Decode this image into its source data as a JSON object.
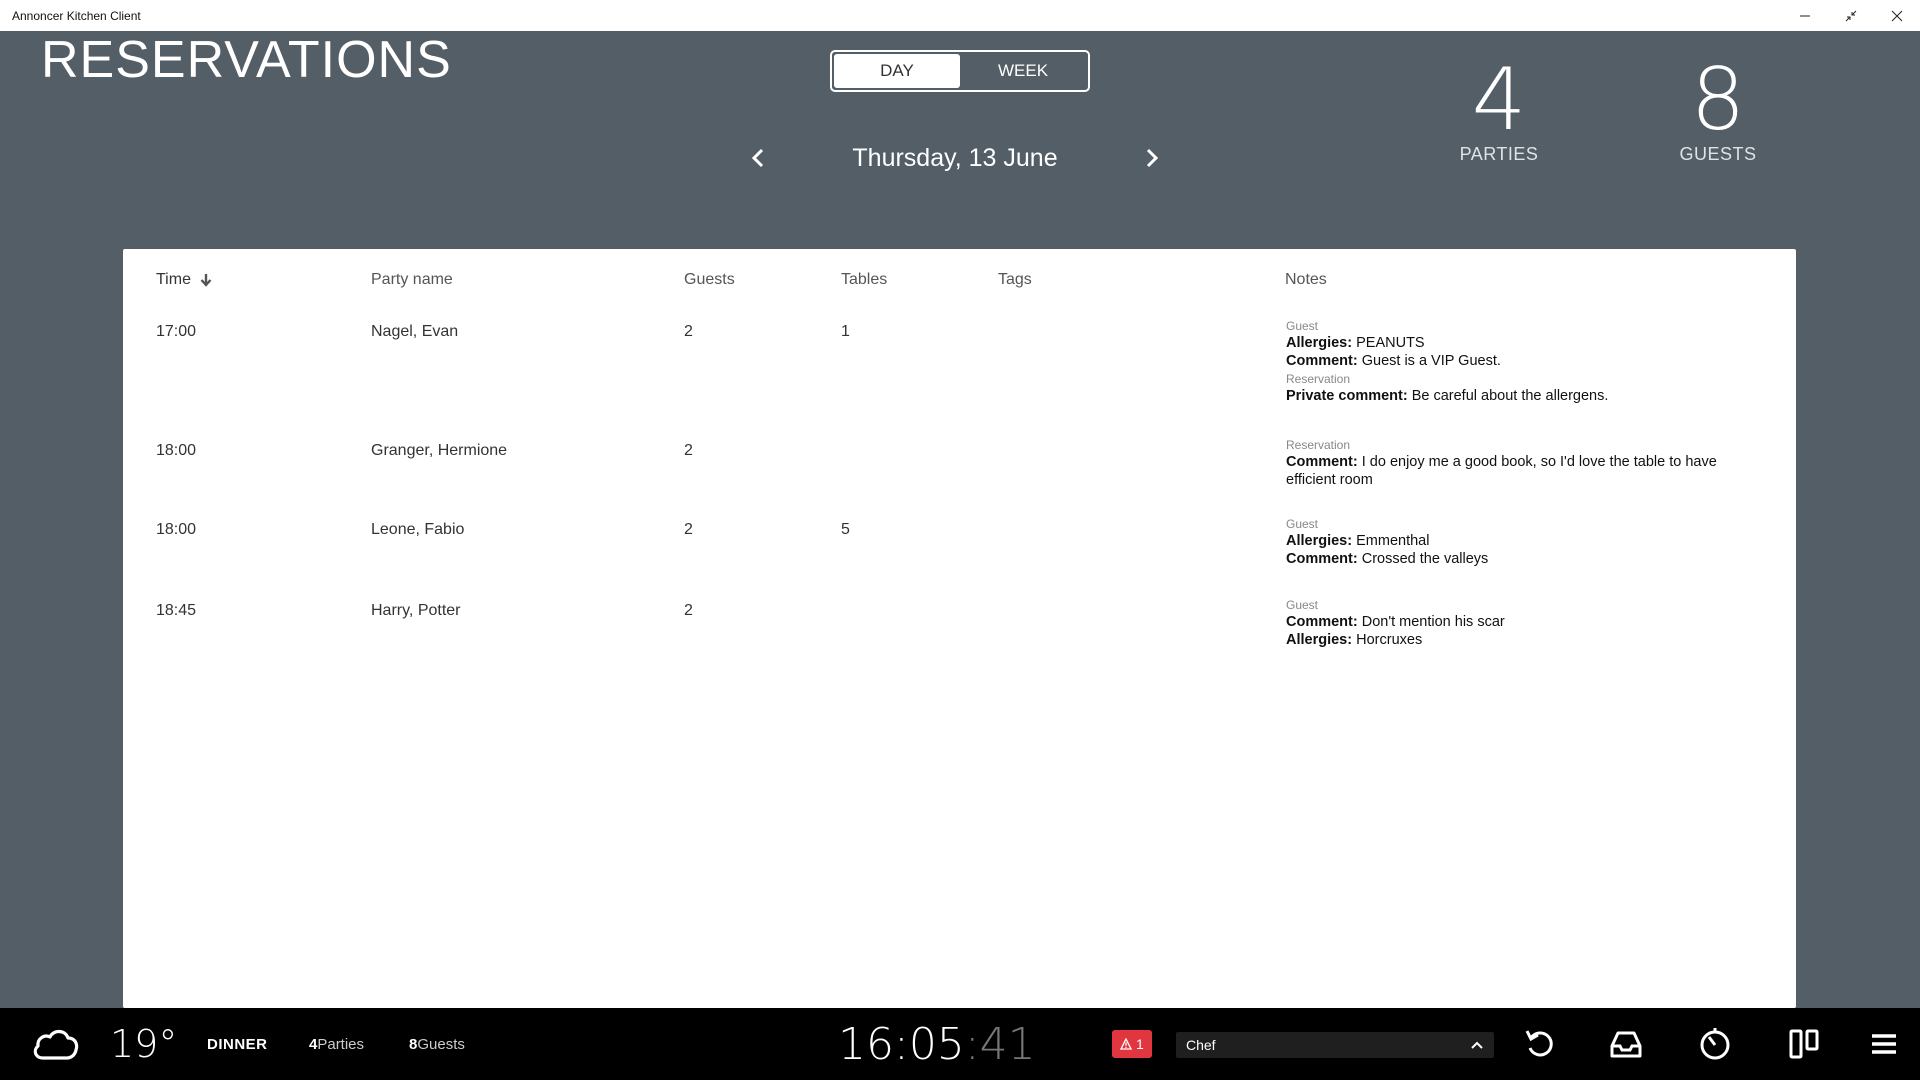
{
  "window": {
    "title": "Annoncer Kitchen Client"
  },
  "header": {
    "title": "RESERVATIONS",
    "view_toggle": {
      "day": "DAY",
      "week": "WEEK",
      "active": "day"
    },
    "date": "Thursday, 13 June",
    "stats": {
      "parties_value": "4",
      "parties_label": "PARTIES",
      "guests_value": "8",
      "guests_label": "GUESTS"
    }
  },
  "table": {
    "columns": {
      "time": "Time",
      "party": "Party name",
      "guests": "Guests",
      "tables": "Tables",
      "tags": "Tags",
      "notes": "Notes"
    },
    "rows": [
      {
        "time": "17:00",
        "party": "Nagel, Evan",
        "guests": "2",
        "tables": "1",
        "tags": "",
        "notes": {
          "s1_label": "Guest",
          "s1_l1_key": "Allergies:",
          "s1_l1_val": " PEANUTS",
          "s1_l2_key": "Comment:",
          "s1_l2_val": " Guest is a VIP Guest.",
          "s2_label": "Reservation",
          "s2_l1_key": "Private comment:",
          "s2_l1_val": " Be careful about the allergens."
        }
      },
      {
        "time": "18:00",
        "party": "Granger, Hermione",
        "guests": "2",
        "tables": "",
        "tags": "",
        "notes": {
          "s1_label": "Reservation",
          "s1_l1_key": "Comment:",
          "s1_l1_val": " I do enjoy me a good book, so I'd love the table to have efficient room"
        }
      },
      {
        "time": "18:00",
        "party": "Leone, Fabio",
        "guests": "2",
        "tables": "5",
        "tags": "",
        "notes": {
          "s1_label": "Guest",
          "s1_l1_key": "Allergies:",
          "s1_l1_val": " Emmenthal",
          "s1_l2_key": "Comment:",
          "s1_l2_val": " Crossed the valleys"
        }
      },
      {
        "time": "18:45",
        "party": "Harry, Potter",
        "guests": "2",
        "tables": "",
        "tags": "",
        "notes": {
          "s1_label": "Guest",
          "s1_l1_key": "Comment:",
          "s1_l1_val": " Don't mention his scar",
          "s1_l2_key": "Allergies:",
          "s1_l2_val": " Horcruxes"
        }
      }
    ]
  },
  "footer": {
    "weather_icon": "cloud-icon",
    "temperature": "19°",
    "service": "DINNER",
    "parties_count": "4",
    "parties_word": " Parties",
    "guests_count": "8",
    "guests_word": " Guests",
    "clock_hm": "16:05",
    "clock_sec": ":41",
    "alert_count": "1",
    "role": "Chef",
    "colors": {
      "alert": "#e0363f",
      "bar": "#000000",
      "background": "#545e66"
    }
  }
}
